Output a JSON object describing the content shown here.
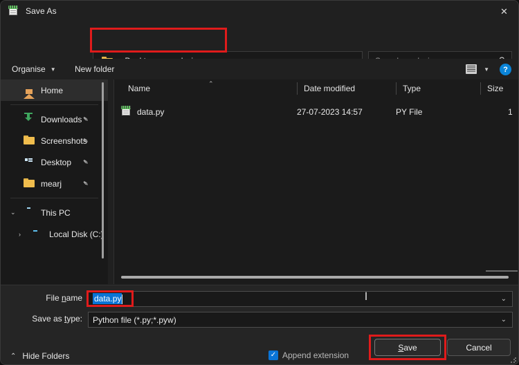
{
  "window": {
    "title": "Save As",
    "title_icon": "notepad-icon",
    "close_label": "✕"
  },
  "nav": {
    "back_icon": "←",
    "forward_icon": "→",
    "recent_icon": "⌄",
    "up_icon": "↑",
    "breadcrumb": {
      "folder_icon": "folder-icon",
      "separator": "›",
      "items": [
        "Desktop",
        "analysis"
      ]
    },
    "history_chevron": "⌄",
    "refresh_icon": "⟳",
    "search": {
      "placeholder": "Search analysis",
      "value": "",
      "icon": "⚲"
    }
  },
  "commandbar": {
    "organise_label": "Organise",
    "organise_caret": "▼",
    "new_folder_label": "New folder",
    "view_caret": "▼",
    "help_label": "?"
  },
  "sidebar": {
    "items": [
      {
        "label": "Home",
        "icon": "home-icon",
        "selected": true,
        "pinned": false
      },
      {
        "label": "Downloads",
        "icon": "downloads-icon",
        "selected": false,
        "pinned": true
      },
      {
        "label": "Screenshots",
        "icon": "folder-icon",
        "selected": false,
        "pinned": true
      },
      {
        "label": "Desktop",
        "icon": "desktop-icon",
        "selected": false,
        "pinned": true
      },
      {
        "label": "mearj",
        "icon": "folder-icon",
        "selected": false,
        "pinned": true
      },
      {
        "label": "This PC",
        "icon": "this-pc-icon",
        "selected": false,
        "pinned": false,
        "expander": "⌄"
      },
      {
        "label": "Local Disk (C:)",
        "icon": "disk-icon",
        "selected": false,
        "pinned": false,
        "expander": "›"
      }
    ],
    "pin_glyph": "✒"
  },
  "filelist": {
    "columns": [
      "Name",
      "Date modified",
      "Type",
      "Size"
    ],
    "sort_caret": "⌃",
    "rows": [
      {
        "name": "data.py",
        "icon": "python-file-icon",
        "date_modified": "27-07-2023 14:57",
        "type": "PY File",
        "size": "1"
      }
    ]
  },
  "form": {
    "filename_label_pre": "File ",
    "filename_label_key": "n",
    "filename_label_post": "ame",
    "filename_value": "data.py",
    "savetype_label_pre": "Save as ",
    "savetype_label_key": "t",
    "savetype_label_post": "ype:",
    "savetype_value": "Python file (*.py;*.pyw)",
    "combo_chevron": "⌄",
    "text_cursor": "I"
  },
  "footer": {
    "hide_folders_label": "Hide Folders",
    "hide_folders_caret": "⌃",
    "append_extension_label": "Append extension",
    "append_extension_checked": true,
    "check_glyph": "✓",
    "save_label_pre": "",
    "save_key": "S",
    "save_label_post": "ave",
    "cancel_label": "Cancel"
  },
  "annotations": {
    "color": "#e01b1b",
    "boxes": [
      "breadcrumb-path",
      "filename-value",
      "save-button"
    ]
  }
}
